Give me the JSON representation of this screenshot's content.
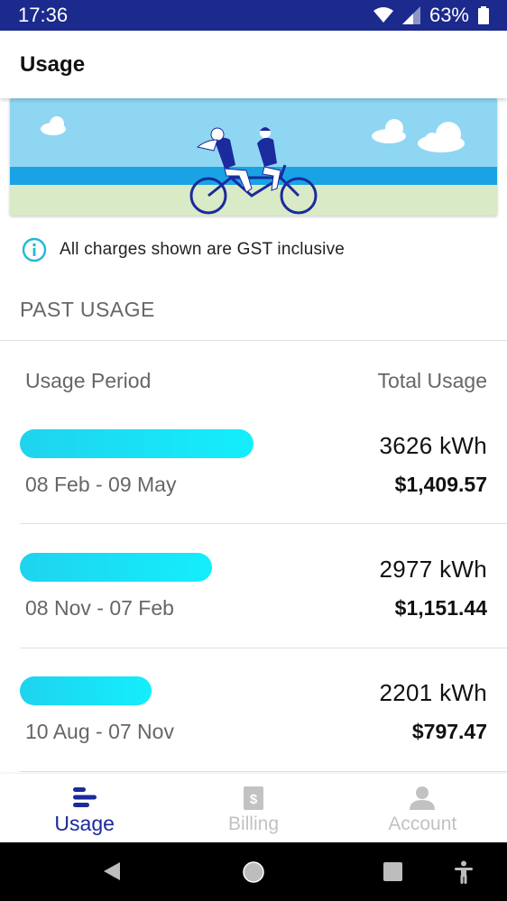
{
  "status_bar": {
    "time": "17:36",
    "battery": "63%"
  },
  "app_bar": {
    "title": "Usage"
  },
  "info": {
    "text": "All charges shown are GST inclusive"
  },
  "past_usage": {
    "section_title": "PAST USAGE",
    "col_period": "Usage Period",
    "col_total": "Total Usage",
    "rows": [
      {
        "period": "08 Feb - 09 May",
        "kwh": "3626 kWh",
        "cost": "$1,409.57",
        "bar_fraction": 0.48
      },
      {
        "period": "08 Nov - 07 Feb",
        "kwh": "2977 kWh",
        "cost": "$1,151.44",
        "bar_fraction": 0.395
      },
      {
        "period": "10 Aug - 07 Nov",
        "kwh": "2201 kWh",
        "cost": "$797.47",
        "bar_fraction": 0.27
      }
    ]
  },
  "bottom_nav": {
    "items": [
      {
        "label": "Usage",
        "icon": "usage-icon",
        "active": true
      },
      {
        "label": "Billing",
        "icon": "billing-icon",
        "active": false
      },
      {
        "label": "Account",
        "icon": "account-icon",
        "active": false
      }
    ]
  },
  "colors": {
    "status_bar": "#1b2a8c",
    "accent": "#1b2a9c",
    "bar": "#14e6fa",
    "info_icon": "#22b8d8"
  }
}
